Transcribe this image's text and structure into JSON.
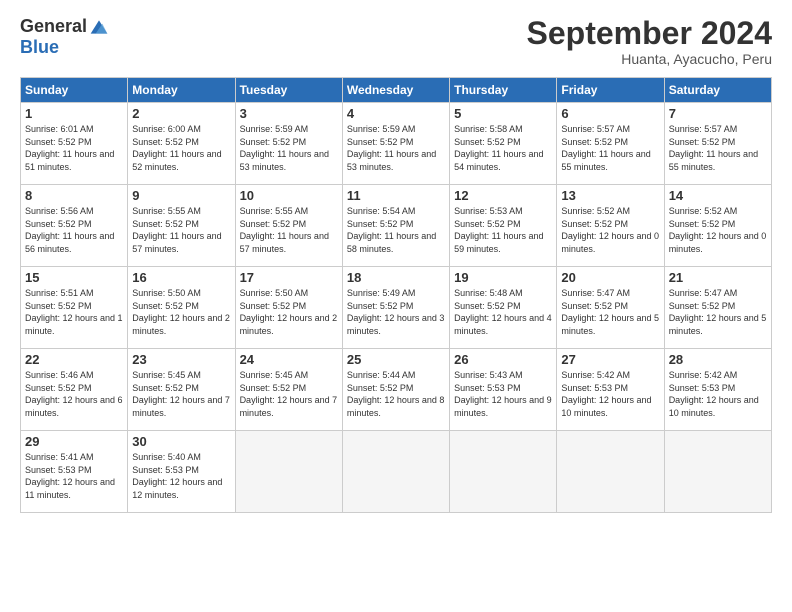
{
  "logo": {
    "general": "General",
    "blue": "Blue"
  },
  "header": {
    "month": "September 2024",
    "location": "Huanta, Ayacucho, Peru"
  },
  "days": [
    "Sunday",
    "Monday",
    "Tuesday",
    "Wednesday",
    "Thursday",
    "Friday",
    "Saturday"
  ],
  "weeks": [
    [
      {
        "num": "1",
        "sunrise": "6:01 AM",
        "sunset": "5:52 PM",
        "daylight": "11 hours and 51 minutes."
      },
      {
        "num": "2",
        "sunrise": "6:00 AM",
        "sunset": "5:52 PM",
        "daylight": "11 hours and 52 minutes."
      },
      {
        "num": "3",
        "sunrise": "5:59 AM",
        "sunset": "5:52 PM",
        "daylight": "11 hours and 53 minutes."
      },
      {
        "num": "4",
        "sunrise": "5:59 AM",
        "sunset": "5:52 PM",
        "daylight": "11 hours and 53 minutes."
      },
      {
        "num": "5",
        "sunrise": "5:58 AM",
        "sunset": "5:52 PM",
        "daylight": "11 hours and 54 minutes."
      },
      {
        "num": "6",
        "sunrise": "5:57 AM",
        "sunset": "5:52 PM",
        "daylight": "11 hours and 55 minutes."
      },
      {
        "num": "7",
        "sunrise": "5:57 AM",
        "sunset": "5:52 PM",
        "daylight": "11 hours and 55 minutes."
      }
    ],
    [
      {
        "num": "8",
        "sunrise": "5:56 AM",
        "sunset": "5:52 PM",
        "daylight": "11 hours and 56 minutes."
      },
      {
        "num": "9",
        "sunrise": "5:55 AM",
        "sunset": "5:52 PM",
        "daylight": "11 hours and 57 minutes."
      },
      {
        "num": "10",
        "sunrise": "5:55 AM",
        "sunset": "5:52 PM",
        "daylight": "11 hours and 57 minutes."
      },
      {
        "num": "11",
        "sunrise": "5:54 AM",
        "sunset": "5:52 PM",
        "daylight": "11 hours and 58 minutes."
      },
      {
        "num": "12",
        "sunrise": "5:53 AM",
        "sunset": "5:52 PM",
        "daylight": "11 hours and 59 minutes."
      },
      {
        "num": "13",
        "sunrise": "5:52 AM",
        "sunset": "5:52 PM",
        "daylight": "12 hours and 0 minutes."
      },
      {
        "num": "14",
        "sunrise": "5:52 AM",
        "sunset": "5:52 PM",
        "daylight": "12 hours and 0 minutes."
      }
    ],
    [
      {
        "num": "15",
        "sunrise": "5:51 AM",
        "sunset": "5:52 PM",
        "daylight": "12 hours and 1 minute."
      },
      {
        "num": "16",
        "sunrise": "5:50 AM",
        "sunset": "5:52 PM",
        "daylight": "12 hours and 2 minutes."
      },
      {
        "num": "17",
        "sunrise": "5:50 AM",
        "sunset": "5:52 PM",
        "daylight": "12 hours and 2 minutes."
      },
      {
        "num": "18",
        "sunrise": "5:49 AM",
        "sunset": "5:52 PM",
        "daylight": "12 hours and 3 minutes."
      },
      {
        "num": "19",
        "sunrise": "5:48 AM",
        "sunset": "5:52 PM",
        "daylight": "12 hours and 4 minutes."
      },
      {
        "num": "20",
        "sunrise": "5:47 AM",
        "sunset": "5:52 PM",
        "daylight": "12 hours and 5 minutes."
      },
      {
        "num": "21",
        "sunrise": "5:47 AM",
        "sunset": "5:52 PM",
        "daylight": "12 hours and 5 minutes."
      }
    ],
    [
      {
        "num": "22",
        "sunrise": "5:46 AM",
        "sunset": "5:52 PM",
        "daylight": "12 hours and 6 minutes."
      },
      {
        "num": "23",
        "sunrise": "5:45 AM",
        "sunset": "5:52 PM",
        "daylight": "12 hours and 7 minutes."
      },
      {
        "num": "24",
        "sunrise": "5:45 AM",
        "sunset": "5:52 PM",
        "daylight": "12 hours and 7 minutes."
      },
      {
        "num": "25",
        "sunrise": "5:44 AM",
        "sunset": "5:52 PM",
        "daylight": "12 hours and 8 minutes."
      },
      {
        "num": "26",
        "sunrise": "5:43 AM",
        "sunset": "5:53 PM",
        "daylight": "12 hours and 9 minutes."
      },
      {
        "num": "27",
        "sunrise": "5:42 AM",
        "sunset": "5:53 PM",
        "daylight": "12 hours and 10 minutes."
      },
      {
        "num": "28",
        "sunrise": "5:42 AM",
        "sunset": "5:53 PM",
        "daylight": "12 hours and 10 minutes."
      }
    ],
    [
      {
        "num": "29",
        "sunrise": "5:41 AM",
        "sunset": "5:53 PM",
        "daylight": "12 hours and 11 minutes."
      },
      {
        "num": "30",
        "sunrise": "5:40 AM",
        "sunset": "5:53 PM",
        "daylight": "12 hours and 12 minutes."
      },
      null,
      null,
      null,
      null,
      null
    ]
  ]
}
